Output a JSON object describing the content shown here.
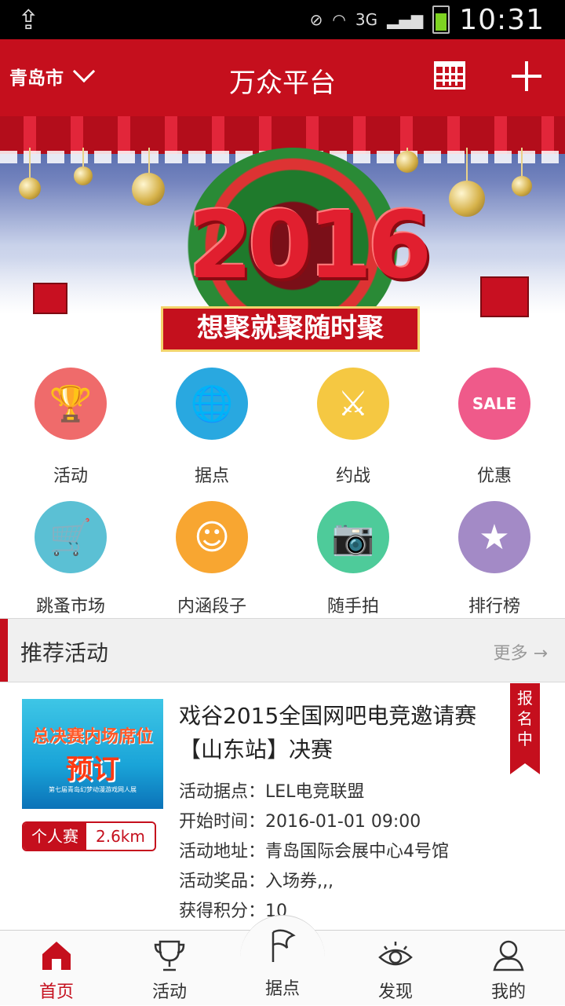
{
  "status_bar": {
    "network": "3G",
    "time": "10:31"
  },
  "header": {
    "city": "青岛市",
    "title": "万众平台",
    "icons": [
      "calendar-icon",
      "plus-icon"
    ]
  },
  "banner": {
    "year": "2016",
    "slogan": "想聚就聚随时聚"
  },
  "grid": [
    {
      "label": "活动",
      "icon": "trophy-icon",
      "color": "#ef6b6b"
    },
    {
      "label": "据点",
      "icon": "globe-pin-icon",
      "color": "#29a8e0"
    },
    {
      "label": "约战",
      "icon": "crossed-swords-icon",
      "color": "#f5c842"
    },
    {
      "label": "优惠",
      "icon": "sale-icon",
      "color": "#ef5a8a"
    },
    {
      "label": "跳蚤市场",
      "icon": "cart-icon",
      "color": "#5bc0d4"
    },
    {
      "label": "内涵段子",
      "icon": "smile-mask-icon",
      "color": "#f8a631"
    },
    {
      "label": "随手拍",
      "icon": "camera-icon",
      "color": "#4ecb9a"
    },
    {
      "label": "排行榜",
      "icon": "medal-icon",
      "color": "#a38ac6"
    }
  ],
  "section": {
    "title": "推荐活动",
    "more": "更多"
  },
  "activity": {
    "thumb_line1": "总决赛内场席位",
    "thumb_line2": "预订",
    "thumb_line3": "第七届青岛幻梦动漫游戏网人展",
    "title": "戏谷2015全国网吧电竞邀请赛【山东站】决赛",
    "tag": "个人赛",
    "distance": "2.6km",
    "status": "报名中",
    "rows": [
      "活动据点：LEL电竞联盟",
      "开始时间：2016-01-01 09:00",
      "活动地址：青岛国际会展中心4号馆",
      "活动奖品：入场券,,,",
      "获得积分：10"
    ]
  },
  "tabs": [
    {
      "label": "首页",
      "icon": "home-icon"
    },
    {
      "label": "活动",
      "icon": "trophy-icon"
    },
    {
      "label": "据点",
      "icon": "flag-icon"
    },
    {
      "label": "发现",
      "icon": "eye-icon"
    },
    {
      "label": "我的",
      "icon": "user-icon"
    }
  ],
  "colors": {
    "brand": "#c50f1d"
  }
}
